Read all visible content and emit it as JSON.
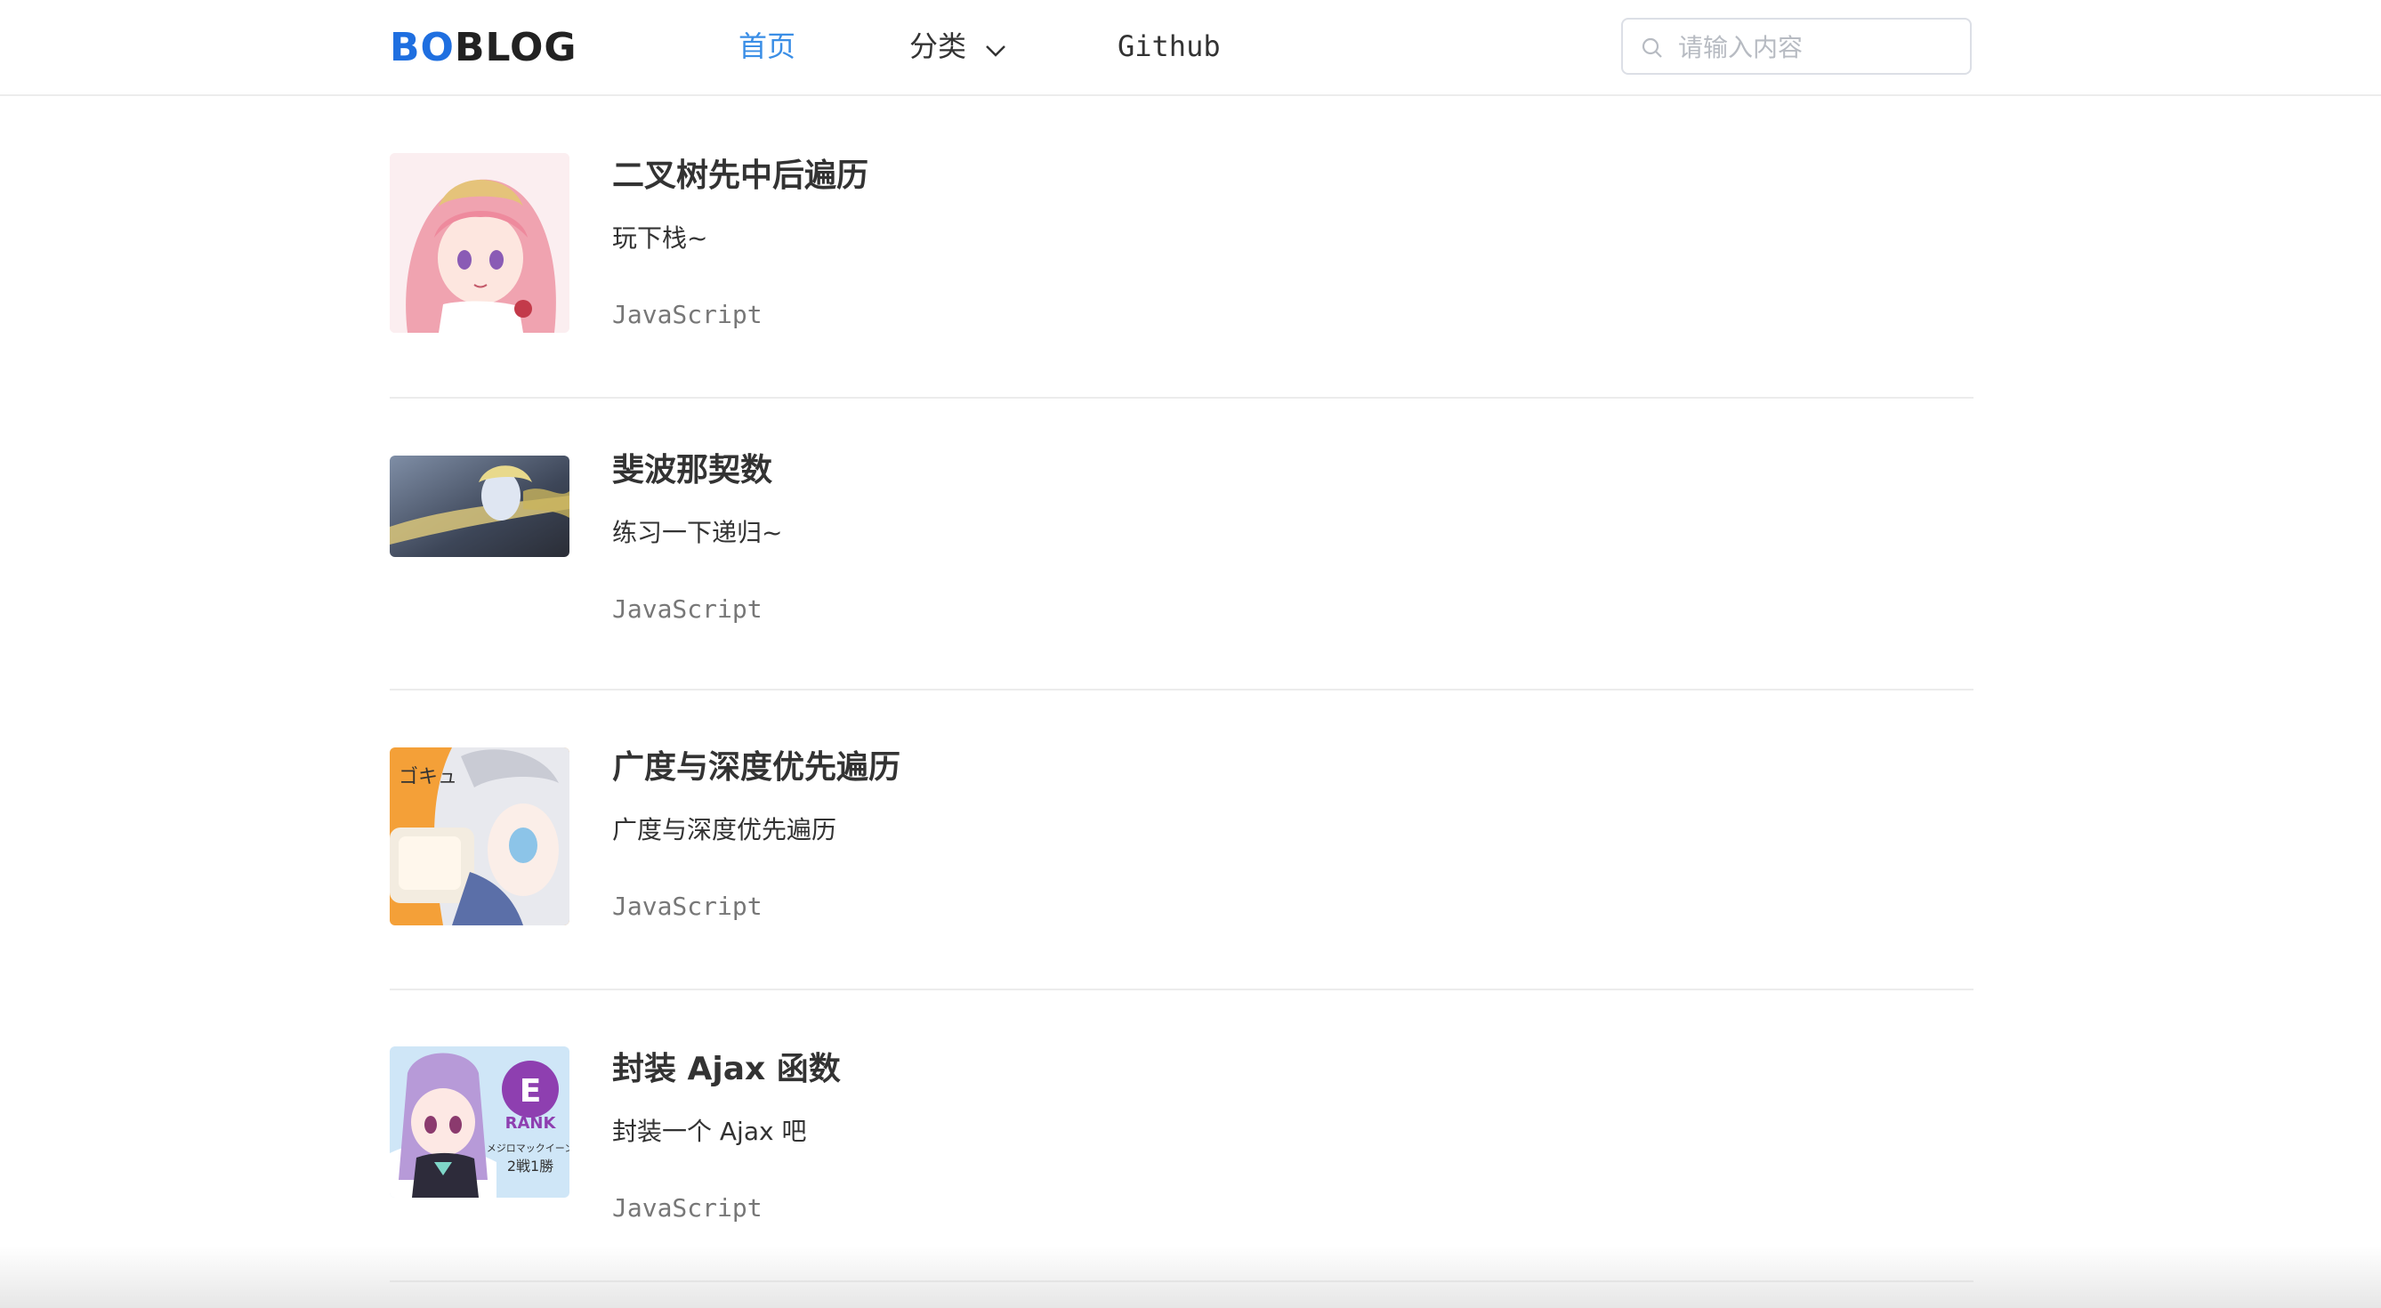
{
  "header": {
    "logo_left": "BO",
    "logo_right": "BLOG",
    "nav": {
      "home": "首页",
      "category": "分类",
      "github": "Github"
    },
    "search": {
      "placeholder": "请输入内容",
      "value": ""
    }
  },
  "posts": [
    {
      "title": "二叉树先中后遍历",
      "desc": "玩下栈~",
      "tag": "JavaScript",
      "thumb": "pink-haired-anime-girl-image"
    },
    {
      "title": "斐波那契数",
      "desc": "练习一下递归~",
      "tag": "JavaScript",
      "thumb": "blonde-anime-character-image"
    },
    {
      "title": "广度与深度优先遍历",
      "desc": "广度与深度优先遍历",
      "tag": "JavaScript",
      "thumb": "silver-haired-girl-drinking-image"
    },
    {
      "title": "封装 Ajax 函数",
      "desc": "封装一个 Ajax 吧",
      "tag": "JavaScript",
      "thumb": "purple-haired-girl-rank-image",
      "thumb_text": [
        "E",
        "RANK",
        "メジロマックイーン",
        "2戦1勝"
      ]
    }
  ],
  "colors": {
    "accent": "#3a8ee6",
    "logo_blue": "#1f6fe0",
    "divider": "#ececec",
    "tag": "#777777"
  }
}
